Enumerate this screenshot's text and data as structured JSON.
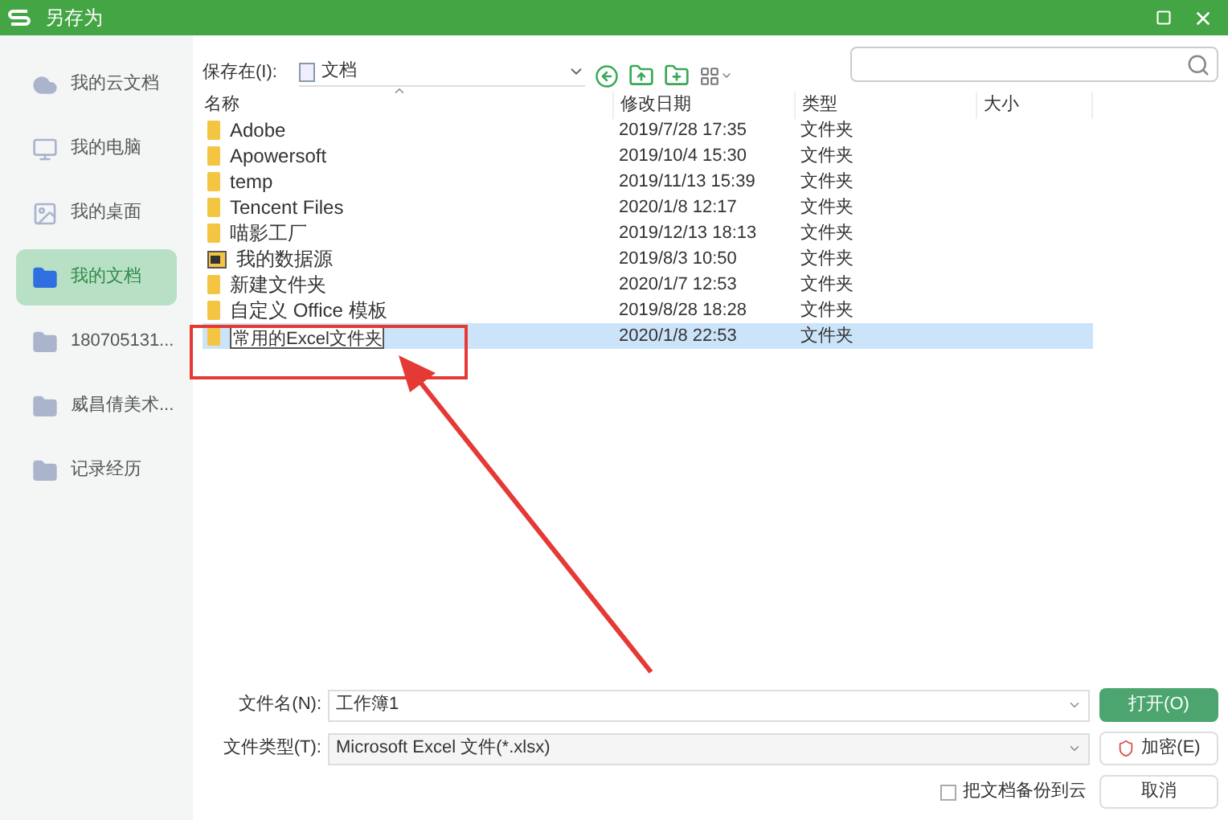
{
  "window": {
    "title": "另存为"
  },
  "sidebar": {
    "items": [
      {
        "label": "我的云文档",
        "kind": "cloud",
        "selected": false
      },
      {
        "label": "我的电脑",
        "kind": "computer",
        "selected": false
      },
      {
        "label": "我的桌面",
        "kind": "desktop",
        "selected": false
      },
      {
        "label": "我的文档",
        "kind": "folder",
        "selected": true
      },
      {
        "label": "180705131...",
        "kind": "folder",
        "selected": false
      },
      {
        "label": "威昌倩美术...",
        "kind": "folder",
        "selected": false
      },
      {
        "label": "记录经历",
        "kind": "folder",
        "selected": false
      }
    ]
  },
  "location": {
    "label": "保存在(I):",
    "value": "文档"
  },
  "table": {
    "columns": [
      "名称",
      "修改日期",
      "类型",
      "大小"
    ],
    "rows": [
      {
        "name": "Adobe",
        "date": "2019/7/28 17:35",
        "type": "文件夹",
        "kind": "folder",
        "selected": false,
        "editing": false
      },
      {
        "name": "Apowersoft",
        "date": "2019/10/4 15:30",
        "type": "文件夹",
        "kind": "folder",
        "selected": false,
        "editing": false
      },
      {
        "name": "temp",
        "date": "2019/11/13 15:39",
        "type": "文件夹",
        "kind": "folder",
        "selected": false,
        "editing": false
      },
      {
        "name": "Tencent Files",
        "date": "2020/1/8 12:17",
        "type": "文件夹",
        "kind": "folder",
        "selected": false,
        "editing": false
      },
      {
        "name": "喵影工厂",
        "date": "2019/12/13 18:13",
        "type": "文件夹",
        "kind": "folder",
        "selected": false,
        "editing": false
      },
      {
        "name": "我的数据源",
        "date": "2019/8/3 10:50",
        "type": "文件夹",
        "kind": "datasource",
        "selected": false,
        "editing": false
      },
      {
        "name": "新建文件夹",
        "date": "2020/1/7 12:53",
        "type": "文件夹",
        "kind": "folder",
        "selected": false,
        "editing": false
      },
      {
        "name": "自定义 Office 模板",
        "date": "2019/8/28 18:28",
        "type": "文件夹",
        "kind": "folder",
        "selected": false,
        "editing": false
      },
      {
        "name": "常用的Excel文件夹",
        "date": "2020/1/8 22:53",
        "type": "文件夹",
        "kind": "folder",
        "selected": true,
        "editing": true
      }
    ]
  },
  "filename": {
    "label": "文件名(N):",
    "value": "工作簿1"
  },
  "filetype": {
    "label": "文件类型(T):",
    "value": "Microsoft Excel 文件(*.xlsx)"
  },
  "backup": {
    "label": "把文档备份到云",
    "checked": false
  },
  "buttons": [
    {
      "label": "打开(O)",
      "kind": "primary"
    },
    {
      "label": "加密(E)",
      "kind": "encrypt"
    },
    {
      "label": "取消",
      "kind": "plain"
    }
  ]
}
